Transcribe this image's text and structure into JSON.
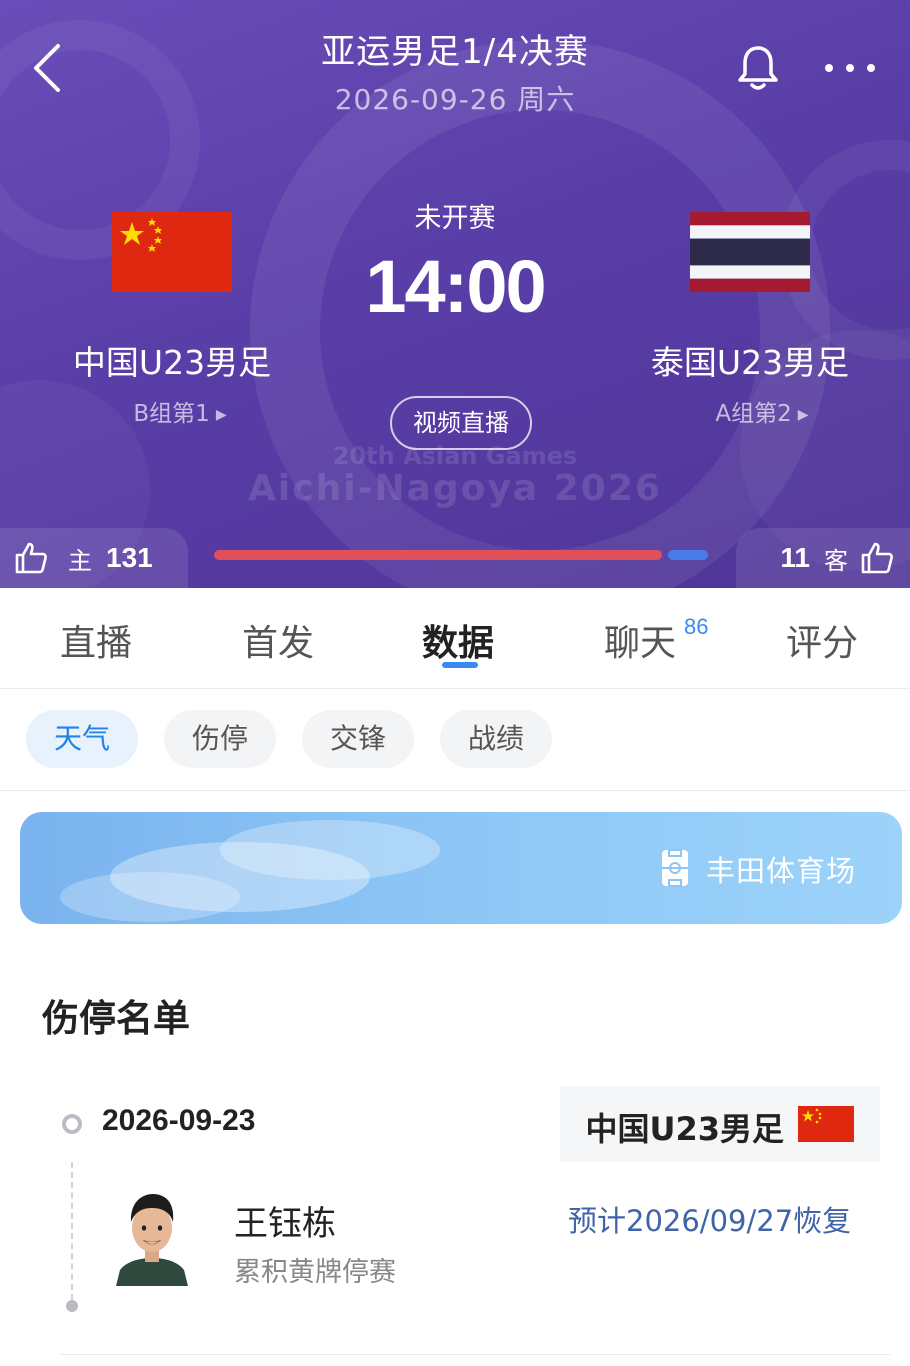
{
  "header": {
    "title": "亚运男足1/4决赛",
    "date": "2026-09-26 周六",
    "status": "未开赛",
    "kickoff_time": "14:00",
    "live_button": "视频直播",
    "watermark_line1": "20th Asian Games",
    "watermark_line2": "Aichi-Nagoya 2026",
    "icons": {
      "back": "back-arrow-icon",
      "bell": "bell-icon",
      "more": "more-icon"
    }
  },
  "home": {
    "name": "中国U23男足",
    "group": "B组第1",
    "flag": "china-flag"
  },
  "away": {
    "name": "泰国U23男足",
    "group": "A组第2",
    "flag": "thailand-flag"
  },
  "votes": {
    "home_label": "主",
    "home_count": "131",
    "away_label": "客",
    "away_count": "11",
    "home_color": "#e0505a",
    "away_color": "#4a7bea"
  },
  "tabs": [
    {
      "label": "直播"
    },
    {
      "label": "首发"
    },
    {
      "label": "数据"
    },
    {
      "label": "聊天",
      "badge": "86"
    },
    {
      "label": "评分"
    }
  ],
  "active_tab": "数据",
  "chips": [
    {
      "label": "天气"
    },
    {
      "label": "伤停"
    },
    {
      "label": "交锋"
    },
    {
      "label": "战绩"
    }
  ],
  "active_chip": "天气",
  "weather": {
    "stadium": "丰田体育场",
    "icon": "stadium-icon"
  },
  "injury": {
    "section_title": "伤停名单",
    "date": "2026-09-23",
    "team": "中国U23男足",
    "player": {
      "name": "王钰栋",
      "reason": "累积黄牌停赛",
      "recovery": "预计2026/09/27恢复"
    }
  },
  "colors": {
    "header_bg": "#5a3ea8",
    "accent": "#3b8af0",
    "chip_active": "#1f83e8",
    "recovery_text": "#3f64a8"
  }
}
